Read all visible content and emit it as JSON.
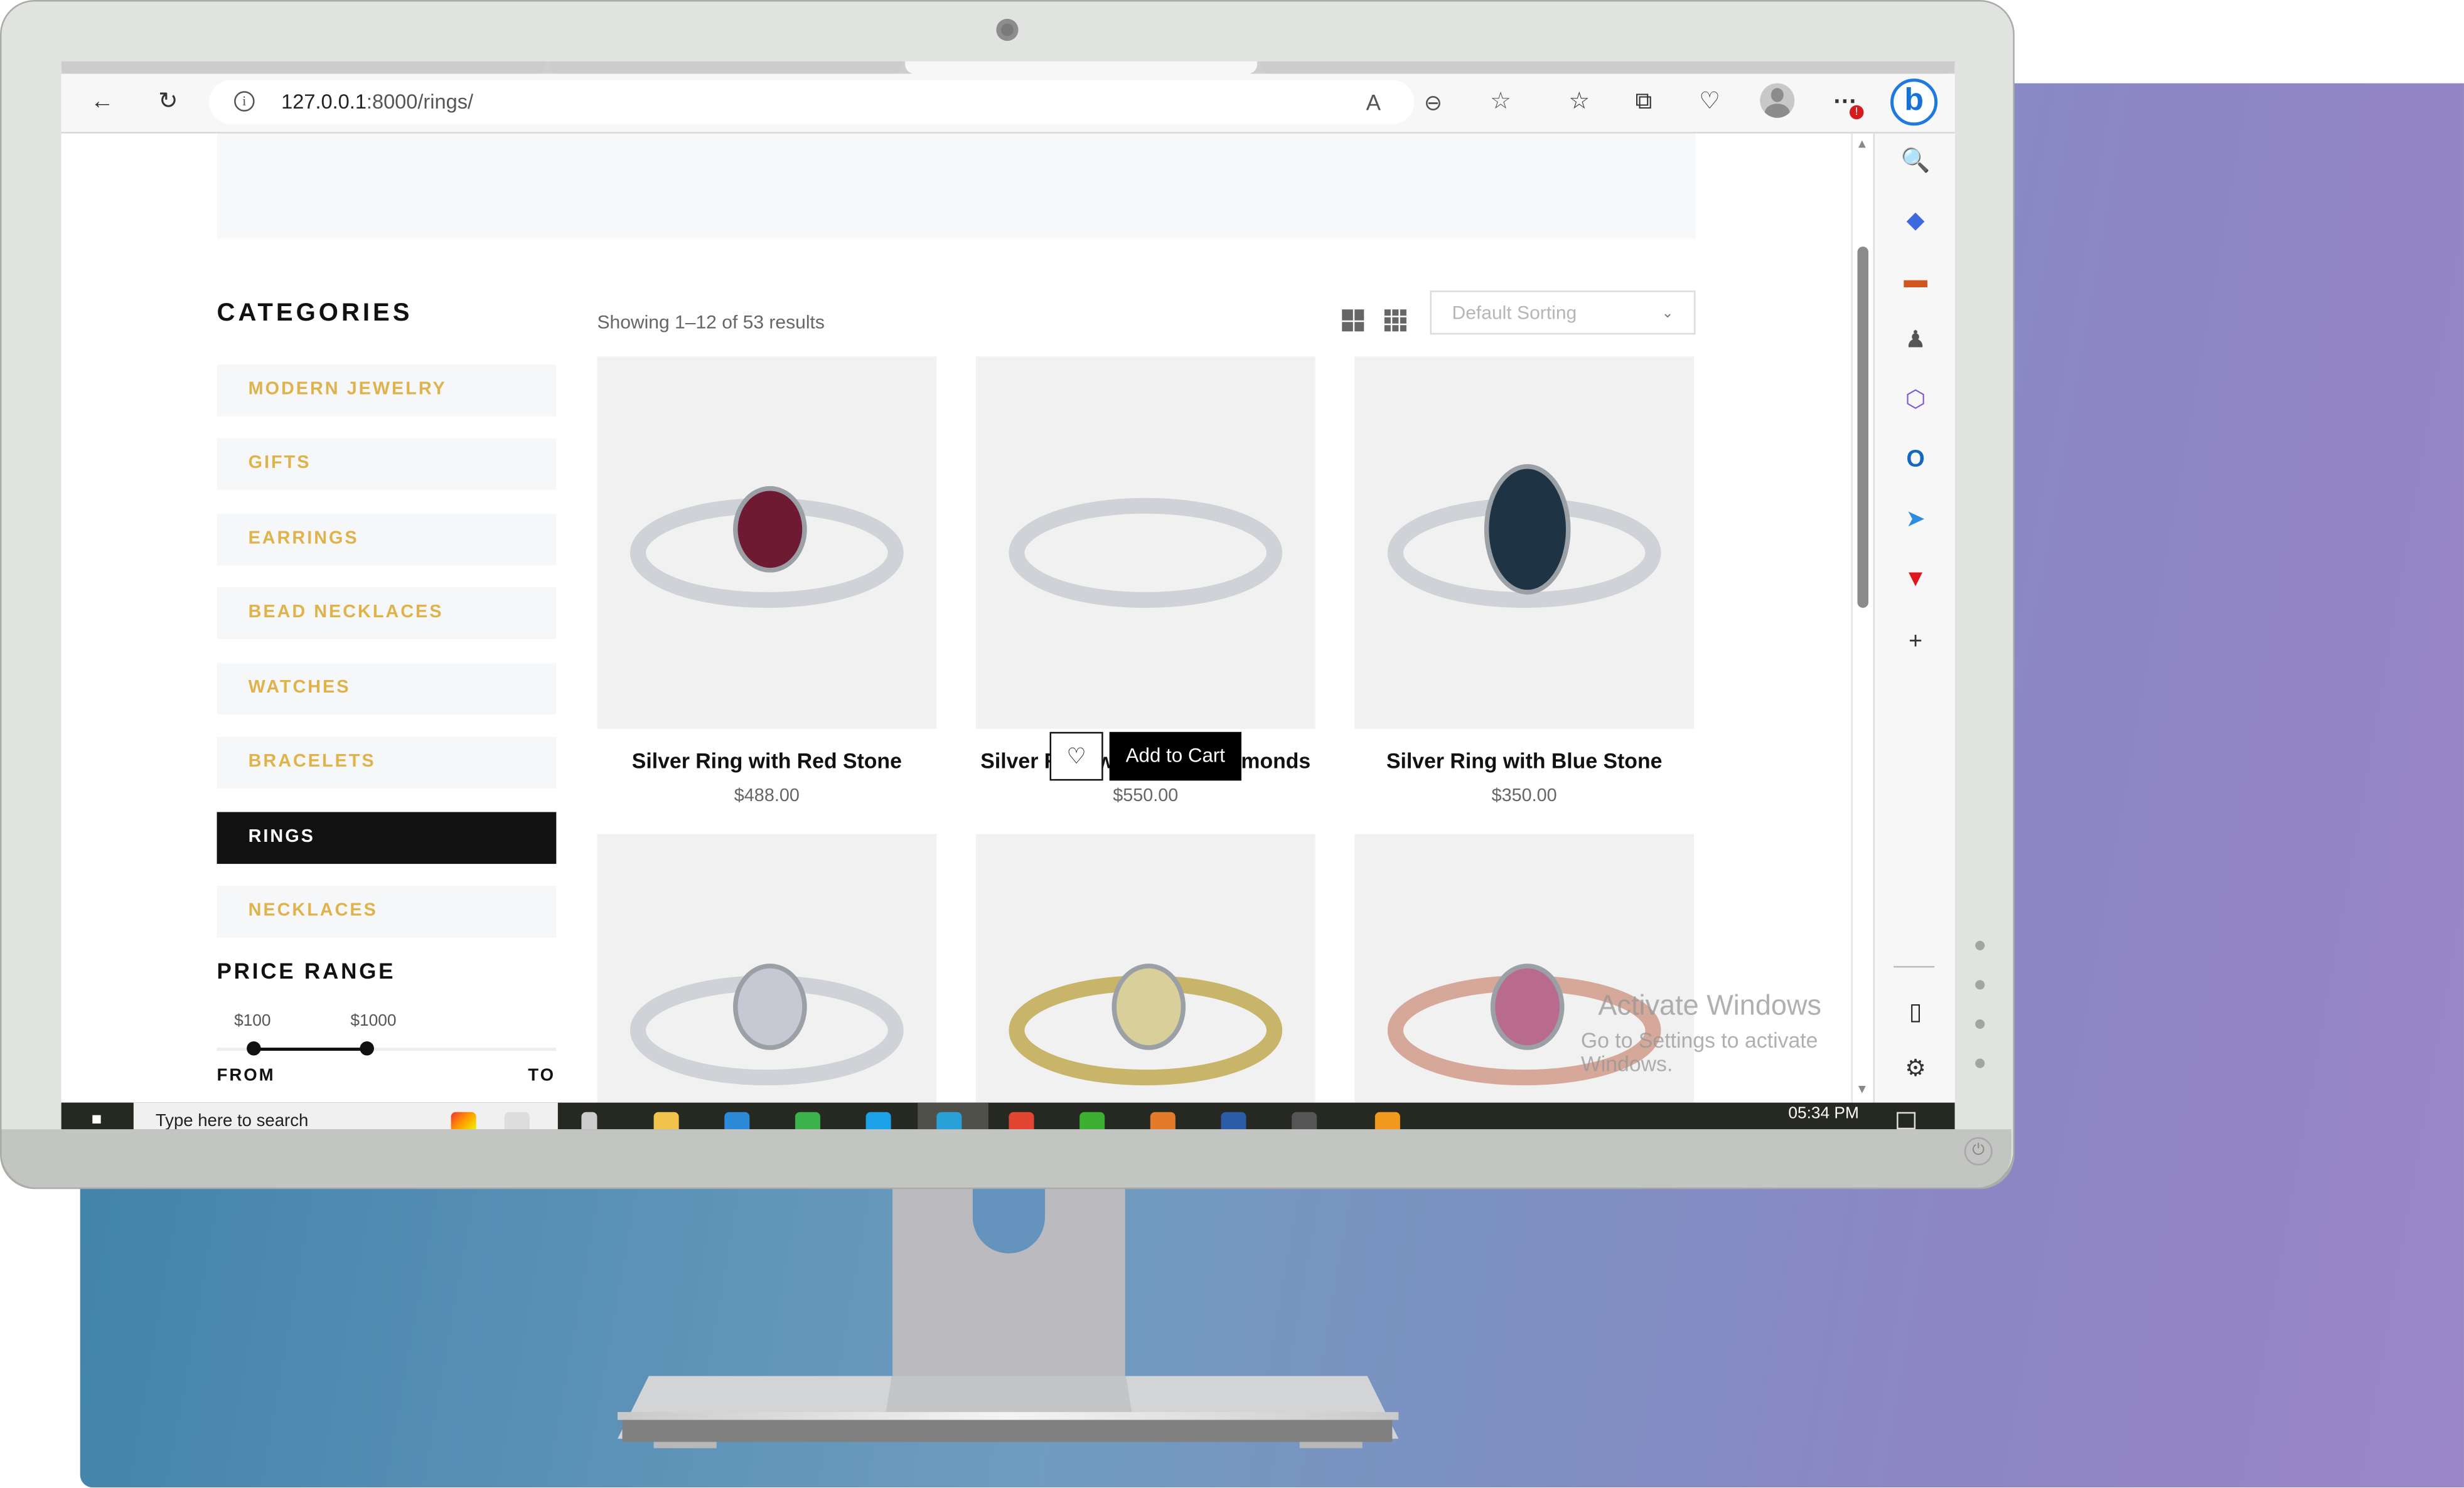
{
  "browser": {
    "url_host": "127.0.0.1",
    "url_path": ":8000/rings/",
    "icons": [
      "back-icon",
      "refresh-icon",
      "info-icon",
      "read-aloud-icon",
      "zoom-out-icon",
      "favorite-star-icon",
      "favorites-list-icon",
      "collections-icon",
      "browser-essentials-icon",
      "profile-avatar-icon",
      "more-menu-icon",
      "bing-copilot-icon"
    ],
    "notification_badge": "!"
  },
  "edge_sidebar": {
    "items": [
      "search-icon",
      "shopping-tag-icon",
      "tools-icon",
      "games-icon",
      "microsoft-365-icon",
      "outlook-icon",
      "send-icon",
      "tubi-icon",
      "add-icon"
    ],
    "bottom": [
      "split-screen-icon",
      "settings-icon"
    ]
  },
  "sidebar": {
    "categories_title": "CATEGORIES",
    "categories": [
      {
        "label": "MODERN JEWELRY",
        "active": false
      },
      {
        "label": "GIFTS",
        "active": false
      },
      {
        "label": "EARRINGS",
        "active": false
      },
      {
        "label": "BEAD NECKLACES",
        "active": false
      },
      {
        "label": "WATCHES",
        "active": false
      },
      {
        "label": "BRACELETS",
        "active": false
      },
      {
        "label": "RINGS",
        "active": true
      },
      {
        "label": "NECKLACES",
        "active": false
      }
    ],
    "price_range_title": "PRICE RANGE",
    "price_min_label": "$100",
    "price_max_label": "$1000",
    "price_min_value": 100,
    "price_max_value": 1000,
    "from_label": "FROM",
    "to_label": "TO"
  },
  "toolbar": {
    "showing_text": "Showing 1–12 of 53 results",
    "sort_selected": "Default Sorting",
    "view_modes": [
      "grid-2-icon",
      "grid-3-icon"
    ]
  },
  "products": [
    {
      "title": "Silver Ring with Red Stone",
      "price": "$488.00",
      "stone_color": "#6e1a33"
    },
    {
      "title": "Silver Ring with Small Diamonds",
      "price": "$550.00",
      "stone_color": "#e9e9e9"
    },
    {
      "title": "Silver Ring with Blue Stone",
      "price": "$350.00",
      "stone_color": "#1e3344"
    },
    {
      "title": "",
      "price": "",
      "stone_color": "#c8c8d4"
    },
    {
      "title": "",
      "price": "",
      "stone_color": "#d9cf9a"
    },
    {
      "title": "",
      "price": "",
      "stone_color": "#b86b8c"
    }
  ],
  "hover_actions": {
    "wishlist_icon": "heart-icon",
    "add_to_cart": "Add to Cart"
  },
  "watermark": {
    "line1": "Activate Windows",
    "line2": "Go to Settings to activate Windows."
  },
  "taskbar": {
    "search_placeholder": "Type here to search",
    "clock": "05:34 PM"
  },
  "colors": {
    "accent_gold": "#e0b24a",
    "active_black": "#111111"
  }
}
